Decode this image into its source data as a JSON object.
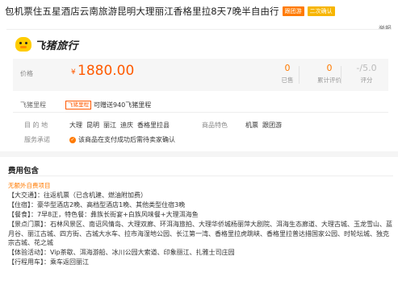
{
  "header": {
    "title": "包机票住五星酒店云南旅游昆明大理丽江香格里拉8天7晚半自由行",
    "tag_primary": "跟团游",
    "tag_secondary": "二次确认",
    "report_link": "举报"
  },
  "brand": {
    "name": "飞猪旅行",
    "logo_icon": "pig-logo-icon"
  },
  "price": {
    "label": "价格",
    "currency": "¥",
    "value": "1880.00",
    "stats": [
      {
        "value": "0",
        "label": "已售"
      },
      {
        "value": "0",
        "label": "累计评价"
      },
      {
        "value": "-/5.0",
        "label": "评分"
      }
    ]
  },
  "points": {
    "label": "飞猪里程",
    "badge": "飞猪里程",
    "text": "可赠送940飞猪里程"
  },
  "destination": {
    "label": "目 的 地",
    "cities": [
      "大理",
      "昆明",
      "丽江",
      "迪庆",
      "香格里拉县"
    ]
  },
  "goods_location": {
    "label": "商品特色",
    "values": [
      "机票",
      "跟团游"
    ]
  },
  "promise": {
    "label": "服务承诺",
    "text": "该商品在支付成功后需待卖家确认",
    "icon": "checkmark-icon"
  },
  "fees": {
    "title": "费用包含",
    "note": "无额外自费项目",
    "lines": [
      "【大交通】：往返机票（已含机建、燃油附加费）",
      "【住宿】：豪华型酒店2晚、高档型酒店1晚、其他类型住宿3晚",
      "【餐食】：7早8正，特色餐：彝族长街宴+白族风味餐+大理洱海鱼",
      "【景点门票】：石林风景区、南诏风情岛、大理双廊、环洱海旅拍、大理华侨城杨丽萍大剧院、洱海生态廊道、大理古城、玉龙雪山、蓝月谷、丽江古城、四方街、古城大水车、拉市海湿地公园、长江第一湾、香格里拉虎跳峡、香格里拉普达措国家公园、时轮坛城、独克宗古城、花之城",
      "【体验活动】：Vip茶歇、洱海游船、冰川公园大索道、印象丽江、扎雅士司庄园",
      "【行程用车】：乘车返回丽江"
    ]
  },
  "colors": {
    "accent": "#ff5a00",
    "tag_orange": "#ff7a00",
    "tag_yellow": "#f7b500"
  }
}
